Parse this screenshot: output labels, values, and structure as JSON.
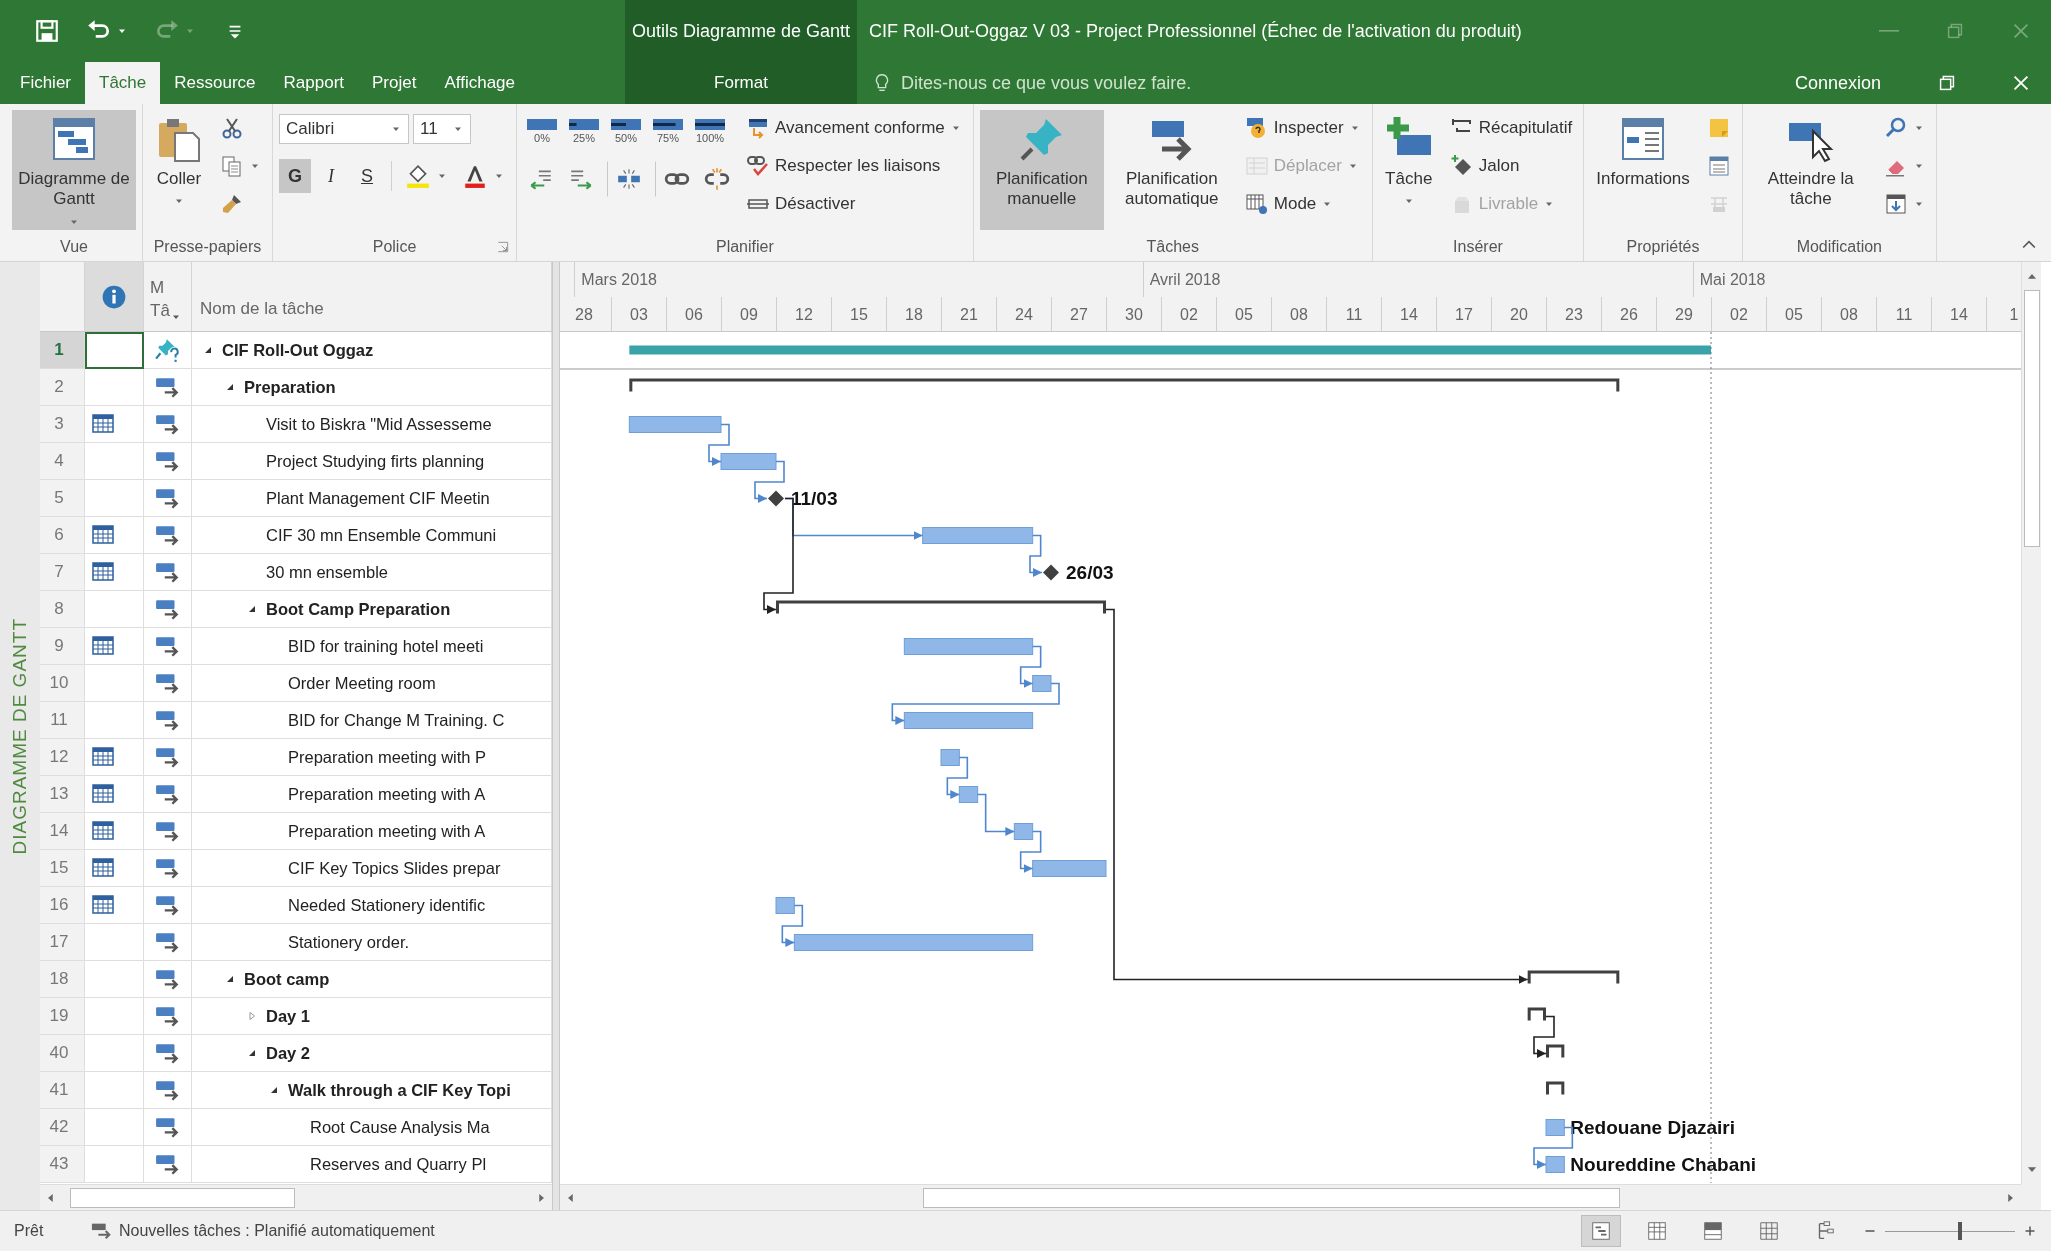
{
  "quick_access": [
    {
      "dropdown": false,
      "disabled": false
    },
    {
      "dropdown": true,
      "disabled": false
    },
    {
      "dropdown": true,
      "disabled": true
    },
    {
      "dropdown": false,
      "disabled": false
    }
  ],
  "window": {
    "context_group": "Outils Diagramme de Gantt",
    "title": "CIF Roll-Out-Oggaz V 03 - Project Professionnel (Échec de l'activation du produit)"
  },
  "tabs": [
    {
      "label": "Fichier",
      "selected": false,
      "kind": "main"
    },
    {
      "label": "Tâche",
      "selected": true,
      "kind": "main"
    },
    {
      "label": "Ressource",
      "selected": false,
      "kind": "main"
    },
    {
      "label": "Rapport",
      "selected": false,
      "kind": "main"
    },
    {
      "label": "Projet",
      "selected": false,
      "kind": "main"
    },
    {
      "label": "Affichage",
      "selected": false,
      "kind": "main"
    },
    {
      "label": "Format",
      "selected": false,
      "kind": "context"
    }
  ],
  "tell_me": {
    "placeholder": "Dites-nous ce que vous voulez faire."
  },
  "account": {
    "label": "Connexion"
  },
  "ribbon": {
    "groups": [
      {
        "label": "Vue",
        "launcher": false,
        "columns": [
          {
            "kind": "large",
            "label": "Diagramme de Gantt",
            "dropdown": true,
            "selected": true,
            "disabled": false
          }
        ]
      },
      {
        "label": "Presse-papiers",
        "launcher": false,
        "columns": [
          {
            "kind": "large",
            "label": "Coller",
            "dropdown": true,
            "selected": false,
            "disabled": false
          },
          {
            "kind": "stack",
            "items": [
              {
                "dropdown": false,
                "disabled": false
              },
              {
                "dropdown": true,
                "disabled": false
              },
              {
                "dropdown": false,
                "disabled": false
              }
            ]
          }
        ]
      },
      {
        "label": "Police",
        "launcher": true,
        "columns": [
          {
            "kind": "font",
            "font": "Calibri",
            "size": "11",
            "styles": [
              {
                "label": "G",
                "selected": true
              },
              {
                "label": "I",
                "selected": false
              },
              {
                "label": "S",
                "selected": false
              }
            ],
            "colors": [
              {
                "color": "#f5e50a"
              },
              {
                "color": "#e0201b"
              }
            ]
          }
        ]
      },
      {
        "label": "Planifier",
        "launcher": false,
        "columns": [
          {
            "kind": "grid",
            "percents": [
              {
                "label": "0%"
              },
              {
                "label": "25%"
              },
              {
                "label": "50%"
              },
              {
                "label": "75%"
              },
              {
                "label": "100%"
              }
            ],
            "icons": [
              {
                "separator": false
              },
              {
                "separator": false
              },
              {
                "separator": true
              },
              {
                "separator": true
              },
              {
                "separator": false
              }
            ]
          },
          {
            "kind": "stack",
            "items": [
              {
                "label": "Avancement conforme",
                "dropdown": true,
                "disabled": false
              },
              {
                "label": "Respecter les liaisons",
                "dropdown": false,
                "disabled": false
              },
              {
                "label": "Désactiver",
                "dropdown": false,
                "disabled": false
              }
            ]
          }
        ]
      },
      {
        "label": "Tâches",
        "launcher": false,
        "columns": [
          {
            "kind": "large",
            "label": "Planification manuelle",
            "dropdown": false,
            "selected": true,
            "disabled": false
          },
          {
            "kind": "large",
            "label": "Planification automatique",
            "dropdown": false,
            "selected": false,
            "disabled": false
          },
          {
            "kind": "stack",
            "items": [
              {
                "label": "Inspecter",
                "dropdown": true,
                "disabled": false
              },
              {
                "label": "Déplacer",
                "dropdown": true,
                "disabled": true
              },
              {
                "label": "Mode",
                "dropdown": true,
                "disabled": false
              }
            ]
          }
        ]
      },
      {
        "label": "Insérer",
        "launcher": false,
        "columns": [
          {
            "kind": "large",
            "label": "Tâche",
            "dropdown": true,
            "selected": false,
            "disabled": false
          },
          {
            "kind": "stack",
            "items": [
              {
                "label": "Récapitulatif",
                "dropdown": false,
                "disabled": false
              },
              {
                "label": "Jalon",
                "dropdown": false,
                "disabled": false
              },
              {
                "label": "Livrable",
                "dropdown": true,
                "disabled": true
              }
            ]
          }
        ]
      },
      {
        "label": "Propriétés",
        "launcher": false,
        "columns": [
          {
            "kind": "large",
            "label": "Informations",
            "dropdown": false,
            "selected": false,
            "disabled": false
          },
          {
            "kind": "stack",
            "items": [
              {
                "dropdown": false,
                "disabled": false
              },
              {
                "dropdown": false,
                "disabled": false
              },
              {
                "dropdown": false,
                "disabled": true
              }
            ]
          }
        ]
      },
      {
        "label": "Modification",
        "launcher": false,
        "columns": [
          {
            "kind": "large",
            "label": "Atteindre la tâche",
            "dropdown": false,
            "selected": false,
            "disabled": false
          },
          {
            "kind": "stack",
            "items": [
              {
                "dropdown": true,
                "disabled": false
              },
              {
                "dropdown": true,
                "disabled": false
              },
              {
                "dropdown": true,
                "disabled": false
              }
            ]
          }
        ]
      }
    ]
  },
  "sheet": {
    "side_label": "DIAGRAMME DE GANTT",
    "columns": [
      {
        "kind": "info"
      },
      {
        "kind": "text",
        "lines": [
          "M",
          "Tâ"
        ],
        "dropdown": true
      },
      {
        "kind": "text",
        "lines": [
          "Nom de la tâche"
        ],
        "dropdown": false
      }
    ]
  },
  "tasks": [
    {
      "id": "1",
      "manual": true,
      "constraint": false,
      "selected": true,
      "summary": true,
      "expanded": true,
      "name": "CIF Roll-Out Oggaz",
      "bar": {
        "kind": "project"
      },
      "children": [
        {
          "id": "2",
          "manual": false,
          "constraint": false,
          "selected": false,
          "summary": true,
          "expanded": true,
          "name": "Preparation",
          "bar": {
            "kind": "summary"
          },
          "children": [
            {
              "id": "3",
              "manual": false,
              "constraint": true,
              "selected": false,
              "summary": false,
              "name": "Visit to Biskra \"Mid Assesseme",
              "bar": {
                "kind": "task"
              }
            },
            {
              "id": "4",
              "manual": false,
              "constraint": false,
              "selected": false,
              "summary": false,
              "name": "Project Studying firts planning",
              "bar": {
                "kind": "task"
              }
            },
            {
              "id": "5",
              "manual": false,
              "constraint": false,
              "selected": false,
              "summary": false,
              "name": "Plant Management CIF Meetin",
              "bar": {
                "kind": "milestone",
                "label": "11/03"
              }
            },
            {
              "id": "6",
              "manual": false,
              "constraint": true,
              "selected": false,
              "summary": false,
              "name": "CIF 30 mn Ensemble Communi",
              "bar": {
                "kind": "task"
              }
            },
            {
              "id": "7",
              "manual": false,
              "constraint": true,
              "selected": false,
              "summary": false,
              "name": "30 mn ensemble",
              "bar": {
                "kind": "milestone",
                "label": "26/03"
              }
            },
            {
              "id": "8",
              "manual": false,
              "constraint": false,
              "selected": false,
              "summary": true,
              "expanded": true,
              "name": "Boot Camp Preparation",
              "bar": {
                "kind": "summary"
              },
              "children": [
                {
                  "id": "9",
                  "manual": false,
                  "constraint": true,
                  "selected": false,
                  "summary": false,
                  "name": "BID for training hotel meeti",
                  "bar": {
                    "kind": "task"
                  }
                },
                {
                  "id": "10",
                  "manual": false,
                  "constraint": false,
                  "selected": false,
                  "summary": false,
                  "name": "Order Meeting room",
                  "bar": {
                    "kind": "task"
                  }
                },
                {
                  "id": "11",
                  "manual": false,
                  "constraint": false,
                  "selected": false,
                  "summary": false,
                  "name": "BID for Change M Training. C",
                  "bar": {
                    "kind": "task"
                  }
                },
                {
                  "id": "12",
                  "manual": false,
                  "constraint": true,
                  "selected": false,
                  "summary": false,
                  "name": "Preparation meeting with P",
                  "bar": {
                    "kind": "task"
                  }
                },
                {
                  "id": "13",
                  "manual": false,
                  "constraint": true,
                  "selected": false,
                  "summary": false,
                  "name": "Preparation meeting with A",
                  "bar": {
                    "kind": "task"
                  }
                },
                {
                  "id": "14",
                  "manual": false,
                  "constraint": true,
                  "selected": false,
                  "summary": false,
                  "name": "Preparation meeting with A",
                  "bar": {
                    "kind": "task"
                  }
                },
                {
                  "id": "15",
                  "manual": false,
                  "constraint": true,
                  "selected": false,
                  "summary": false,
                  "name": "CIF Key Topics Slides prepar",
                  "bar": {
                    "kind": "task"
                  }
                },
                {
                  "id": "16",
                  "manual": false,
                  "constraint": true,
                  "selected": false,
                  "summary": false,
                  "name": "Needed Stationery identific",
                  "bar": {
                    "kind": "task"
                  }
                },
                {
                  "id": "17",
                  "manual": false,
                  "constraint": false,
                  "selected": false,
                  "summary": false,
                  "name": "Stationery order.",
                  "bar": {
                    "kind": "task"
                  }
                }
              ]
            }
          ]
        },
        {
          "id": "18",
          "manual": false,
          "constraint": false,
          "selected": false,
          "summary": true,
          "expanded": true,
          "name": "Boot camp",
          "bar": {
            "kind": "summary"
          },
          "children": [
            {
              "id": "19",
              "manual": false,
              "constraint": false,
              "selected": false,
              "summary": true,
              "expanded": false,
              "name": "Day 1",
              "bar": {
                "kind": "summary"
              }
            },
            {
              "id": "40",
              "manual": false,
              "constraint": false,
              "selected": false,
              "summary": true,
              "expanded": true,
              "name": "Day 2",
              "bar": {
                "kind": "summary"
              },
              "children": [
                {
                  "id": "41",
                  "manual": false,
                  "constraint": false,
                  "selected": false,
                  "summary": true,
                  "expanded": true,
                  "name": "Walk through a CIF Key Topi",
                  "bar": {
                    "kind": "summary"
                  },
                  "children": [
                    {
                      "id": "42",
                      "manual": false,
                      "constraint": false,
                      "selected": false,
                      "summary": false,
                      "name": "Root Cause Analysis Ma",
                      "bar": {
                        "kind": "task",
                        "label": "Redouane Djazairi"
                      }
                    },
                    {
                      "id": "43",
                      "manual": false,
                      "constraint": false,
                      "selected": false,
                      "summary": false,
                      "name": "Reserves and Quarry Pl",
                      "bar": {
                        "kind": "task",
                        "label": "Noureddine Chabani"
                      }
                    }
                  ]
                }
              ]
            }
          ]
        }
      ]
    }
  ],
  "gantt": {
    "timescale": {
      "months": [
        "Mars 2018",
        "Avril 2018",
        "Mai 2018"
      ],
      "days": [
        "28",
        "03",
        "06",
        "09",
        "12",
        "15",
        "18",
        "21",
        "24",
        "27",
        "30",
        "02",
        "05",
        "08",
        "11",
        "14",
        "17",
        "20",
        "23",
        "26",
        "29",
        "02",
        "05",
        "08",
        "11",
        "14",
        "1"
      ]
    }
  },
  "status_bar": {
    "ready": "Prêt",
    "new_tasks": "Nouvelles tâches : Planifié automatiquement",
    "views": [
      {
        "selected": true
      },
      {
        "selected": false
      },
      {
        "selected": false
      },
      {
        "selected": false
      },
      {
        "selected": false
      }
    ],
    "zoom": {
      "level": 0.58
    }
  }
}
